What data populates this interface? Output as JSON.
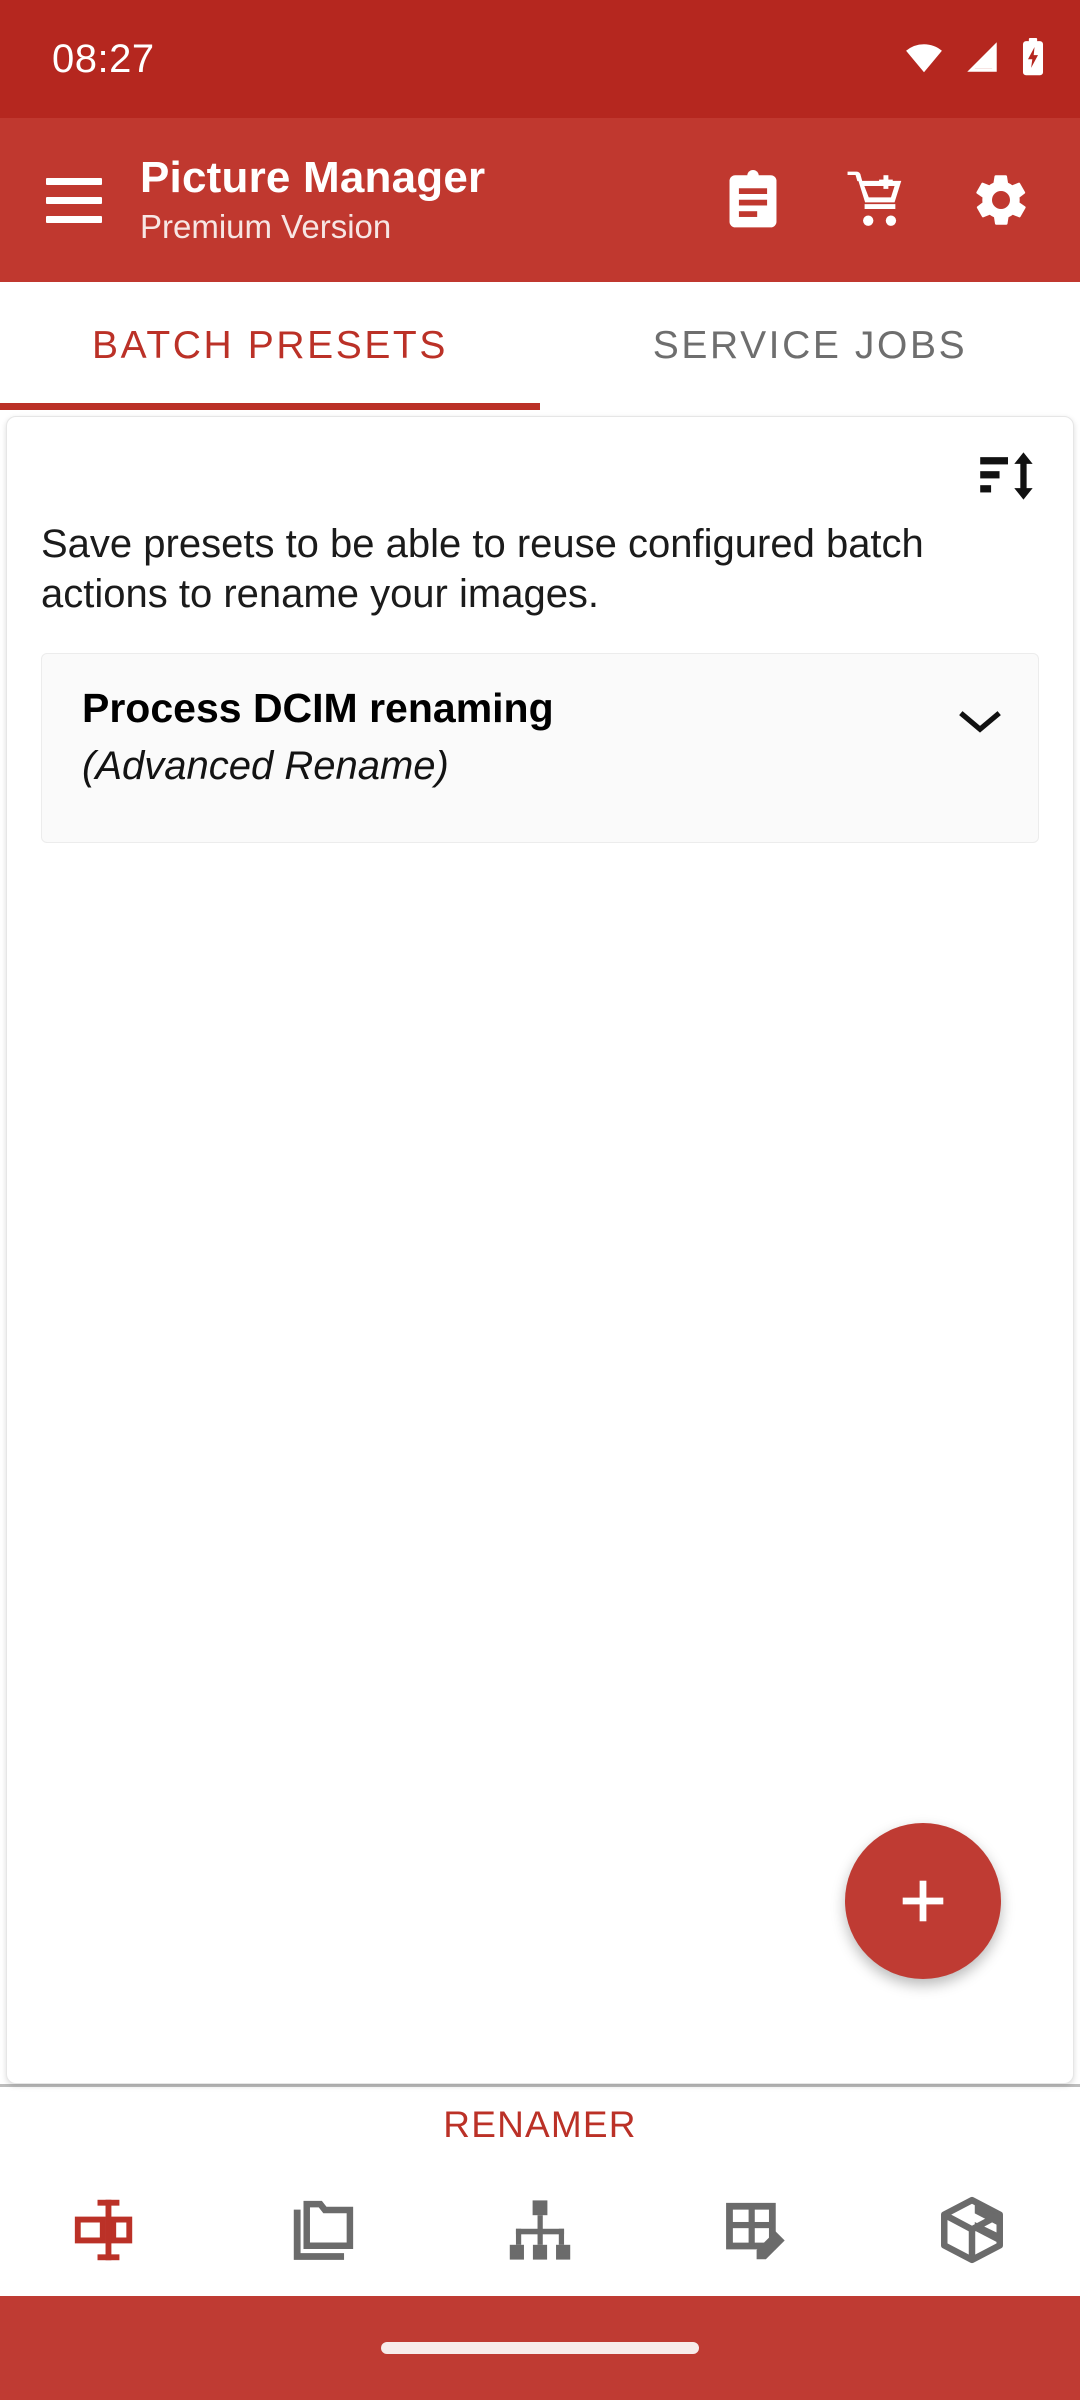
{
  "status_bar": {
    "time": "08:27",
    "icons": [
      "wifi-icon",
      "signal-icon",
      "battery-charging-icon"
    ]
  },
  "app_bar": {
    "menu_icon": "hamburger-menu-icon",
    "title": "Picture Manager",
    "subtitle": "Premium Version",
    "actions": [
      {
        "name": "clipboard-icon",
        "label": "Clipboard"
      },
      {
        "name": "add-to-cart-icon",
        "label": "Add to cart"
      },
      {
        "name": "gear-icon",
        "label": "Settings"
      }
    ]
  },
  "tabs": {
    "items": [
      {
        "label": "BATCH PRESETS",
        "active": true
      },
      {
        "label": "SERVICE JOBS",
        "active": false
      }
    ]
  },
  "content": {
    "sort_icon": "sort-icon",
    "description": "Save presets to be able to reuse configured batch actions to rename your images.",
    "presets": [
      {
        "title": "Process DCIM renaming",
        "subtitle": "(Advanced Rename)",
        "expand_icon": "chevron-down-icon"
      }
    ],
    "fab": {
      "icon": "plus-icon",
      "label": "Add preset"
    }
  },
  "bottom": {
    "module_label": "RENAMER",
    "nav_items": [
      {
        "name": "rename-icon",
        "active": true
      },
      {
        "name": "folder-copy-icon",
        "active": false
      },
      {
        "name": "hierarchy-icon",
        "active": false
      },
      {
        "name": "table-edit-icon",
        "active": false
      },
      {
        "name": "box-package-icon",
        "active": false
      }
    ]
  },
  "gesture_bar": {
    "pill": "home-gesture-pill"
  },
  "colors": {
    "status_bar": "#b5271f",
    "app_bar": "#c0382f",
    "accent": "#bb3127",
    "fab": "#bf3b33",
    "inactive_tab": "#6e6e6e",
    "nav_inactive": "#6b6b6b"
  }
}
